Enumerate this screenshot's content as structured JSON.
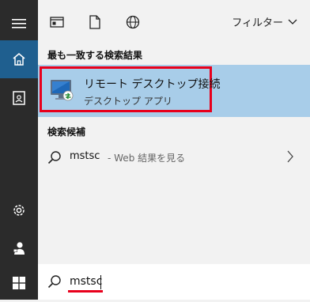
{
  "rail": {
    "items": [
      {
        "icon": "hamburger-menu-icon"
      },
      {
        "icon": "home-icon",
        "active": true
      },
      {
        "icon": "document-user-icon"
      },
      {
        "icon": "gear-icon"
      },
      {
        "icon": "user-icon"
      },
      {
        "icon": "windows-start-icon"
      }
    ]
  },
  "toolbar": {
    "filter_label": "フィルター"
  },
  "best_match": {
    "section_label": "最も一致する検索結果",
    "app_title": "リモート デスクトップ接続",
    "app_subtitle": "デスクトップ アプリ"
  },
  "suggestions": {
    "section_label": "検索候補",
    "query": "mstsc",
    "hint": "- Web 結果を見る"
  },
  "search": {
    "value": "mstsc"
  },
  "colors": {
    "accent_bg": "#a8cde9",
    "highlight": "#e8001c",
    "rail_bg": "#2b2b2b",
    "rail_active": "#1f5f8f"
  }
}
